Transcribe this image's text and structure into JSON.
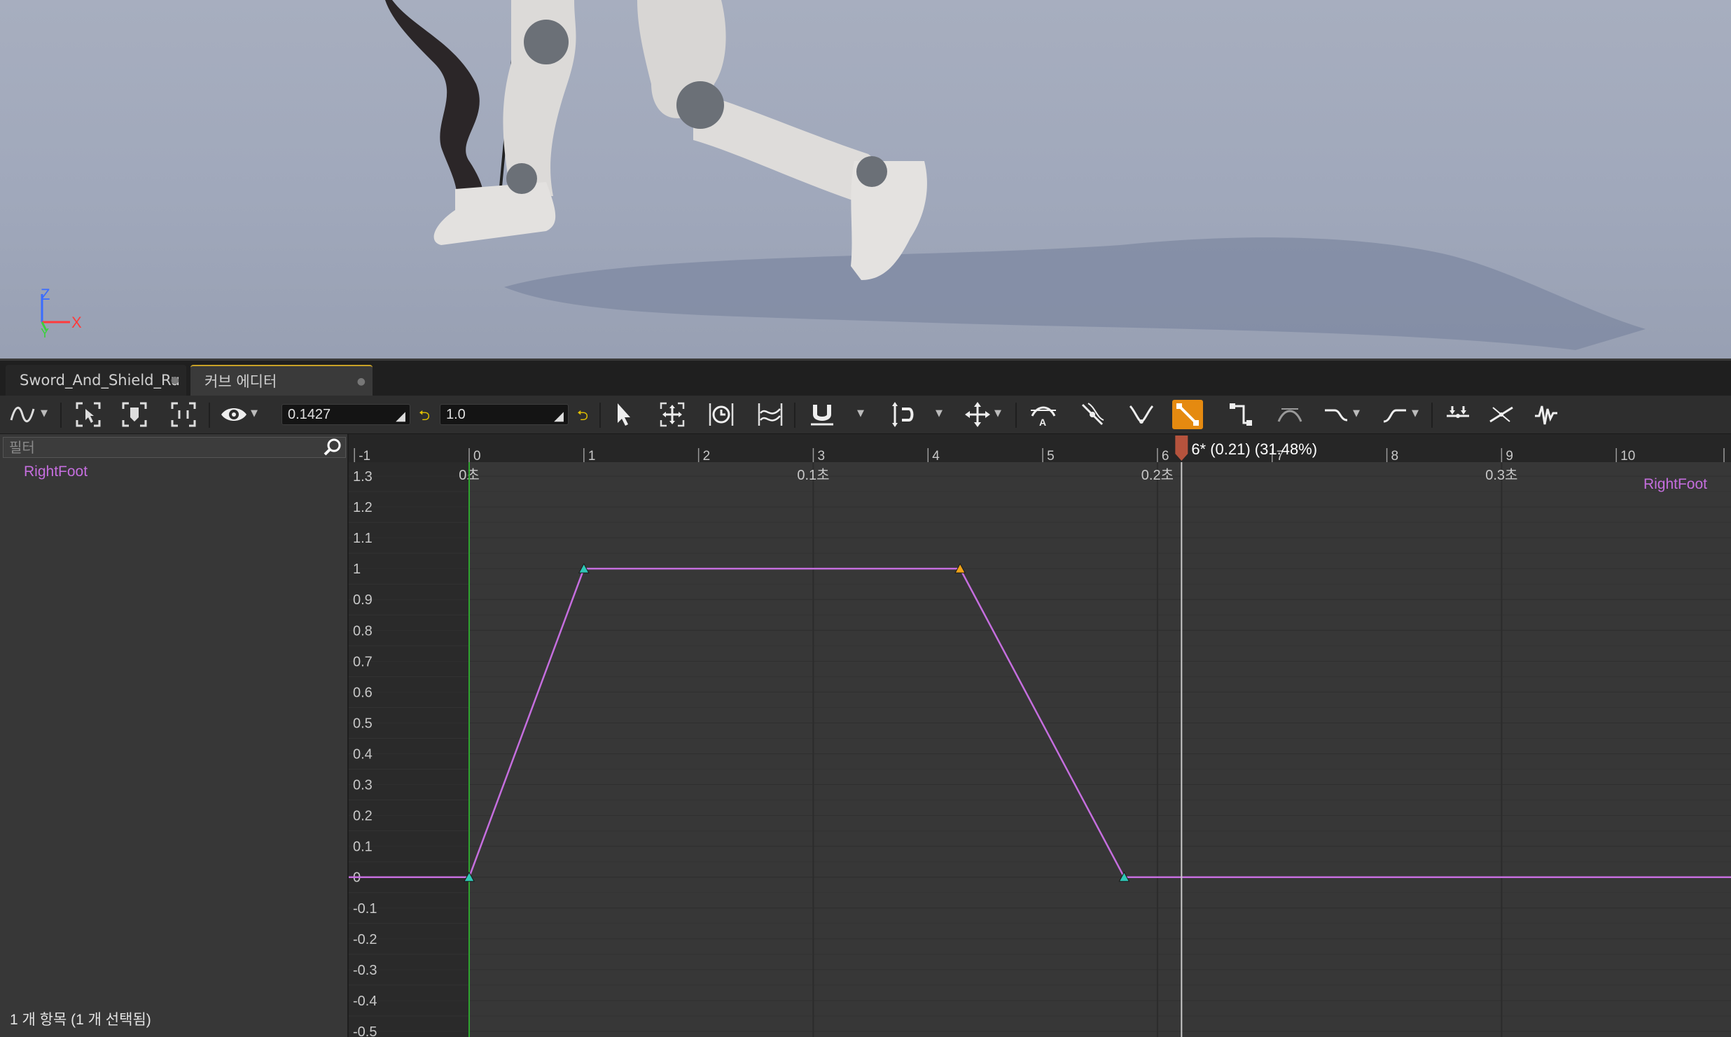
{
  "viewport": {
    "axis_z": "Z",
    "axis_x": "X",
    "axis_y": "Y"
  },
  "tabs": [
    {
      "label": "Sword_And_Shield_Ru",
      "active": false
    },
    {
      "label": "커브 에디터",
      "active": true
    }
  ],
  "toolbar": {
    "time_value": "0.1427",
    "value_field": "1.0",
    "active_tool": "linear-interpolation",
    "accent_color": "#e58a10"
  },
  "left_panel": {
    "filter_placeholder": "필터",
    "curves": [
      {
        "name": "RightFoot",
        "color": "#c56ede"
      }
    ],
    "status": "1 개 항목 (1 개 선택됨)"
  },
  "graph": {
    "curve_label": "RightFoot",
    "curve_color": "#c56ede",
    "playhead_label": "6* (0.21) (31.48%)",
    "playhead_frame": 6.21,
    "frame_ticks": [
      "-1",
      "0",
      "1",
      "2",
      "3",
      "4",
      "5",
      "6",
      "7",
      "8",
      "9",
      "10"
    ],
    "time_ticks": [
      {
        "label": "0초",
        "frame": 0
      },
      {
        "label": "0.1초",
        "frame": 3
      },
      {
        "label": "0.2초",
        "frame": 6
      },
      {
        "label": "0.3초",
        "frame": 9
      }
    ],
    "y_ticks": [
      "1.3",
      "1.2",
      "1.1",
      "1",
      "0.9",
      "0.8",
      "0.7",
      "0.6",
      "0.5",
      "0.4",
      "0.3",
      "0.2",
      "0.1",
      "0",
      "-0.1",
      "-0.2",
      "-0.3",
      "-0.4",
      "-0.5"
    ],
    "keys": [
      {
        "frame": 0,
        "value": 0,
        "state": "normal"
      },
      {
        "frame": 1,
        "value": 1,
        "state": "normal"
      },
      {
        "frame": 4.28,
        "value": 1,
        "state": "selected"
      },
      {
        "frame": 5.71,
        "value": 0,
        "state": "normal"
      }
    ],
    "x_range": [
      -1.05,
      11.0
    ],
    "y_range": [
      -0.5,
      1.3
    ]
  }
}
